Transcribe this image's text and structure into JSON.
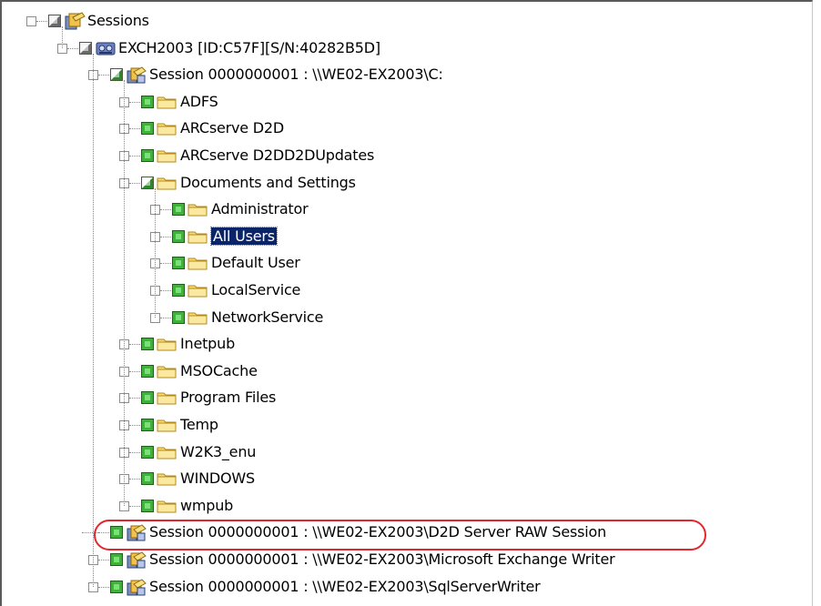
{
  "tree": {
    "root": {
      "label": "Sessions",
      "icon": "sessions-icon",
      "expander": "−",
      "check": "grey"
    },
    "server": {
      "label": "EXCH2003 [ID:C57F][S/N:40282B5D]",
      "icon": "server-tape-icon",
      "expander": "−",
      "check": "grey"
    },
    "session_c": {
      "label": "Session 0000000001 : \\\\WE02-EX2003\\C:",
      "icon": "session-icon",
      "expander": "−",
      "check": "partial"
    },
    "c_folders": [
      {
        "label": "ADFS",
        "expander": "+",
        "check": "full"
      },
      {
        "label": "ARCserve D2D",
        "expander": "+",
        "check": "full"
      },
      {
        "label": "ARCserve D2DD2DUpdates",
        "expander": "+",
        "check": "full"
      },
      {
        "label": "Documents and Settings",
        "expander": "−",
        "check": "partial"
      }
    ],
    "docs_children": [
      {
        "label": "Administrator",
        "expander": "+",
        "check": "full",
        "selected": false
      },
      {
        "label": "All Users",
        "expander": "+",
        "check": "full",
        "selected": true
      },
      {
        "label": "Default User",
        "expander": "+",
        "check": "full",
        "selected": false
      },
      {
        "label": "LocalService",
        "expander": "+",
        "check": "full",
        "selected": false
      },
      {
        "label": "NetworkService",
        "expander": "+",
        "check": "full",
        "selected": false
      }
    ],
    "c_folders_more": [
      {
        "label": "Inetpub",
        "expander": "+",
        "check": "full"
      },
      {
        "label": "MSOCache",
        "expander": "+",
        "check": "full"
      },
      {
        "label": "Program Files",
        "expander": "+",
        "check": "full"
      },
      {
        "label": "Temp",
        "expander": "+",
        "check": "full"
      },
      {
        "label": "W2K3_enu",
        "expander": "+",
        "check": "full"
      },
      {
        "label": "WINDOWS",
        "expander": "+",
        "check": "full"
      },
      {
        "label": "wmpub",
        "expander": "+",
        "check": "full"
      }
    ],
    "sessions_more": [
      {
        "label": "Session 0000000001 : \\\\WE02-EX2003\\D2D Server RAW Session",
        "icon": "session-icon",
        "expander": "",
        "check": "full",
        "highlighted": true
      },
      {
        "label": "Session 0000000001 : \\\\WE02-EX2003\\Microsoft Exchange Writer",
        "icon": "session-icon",
        "expander": "+",
        "check": "full",
        "highlighted": false
      },
      {
        "label": "Session 0000000001 : \\\\WE02-EX2003\\SqlServerWriter",
        "icon": "session-icon",
        "expander": "+",
        "check": "full",
        "highlighted": false
      }
    ]
  },
  "colors": {
    "selection": "#0a246a",
    "callout": "#e2262e",
    "folder": "#f6d86a",
    "check_green": "#3fb23a"
  }
}
